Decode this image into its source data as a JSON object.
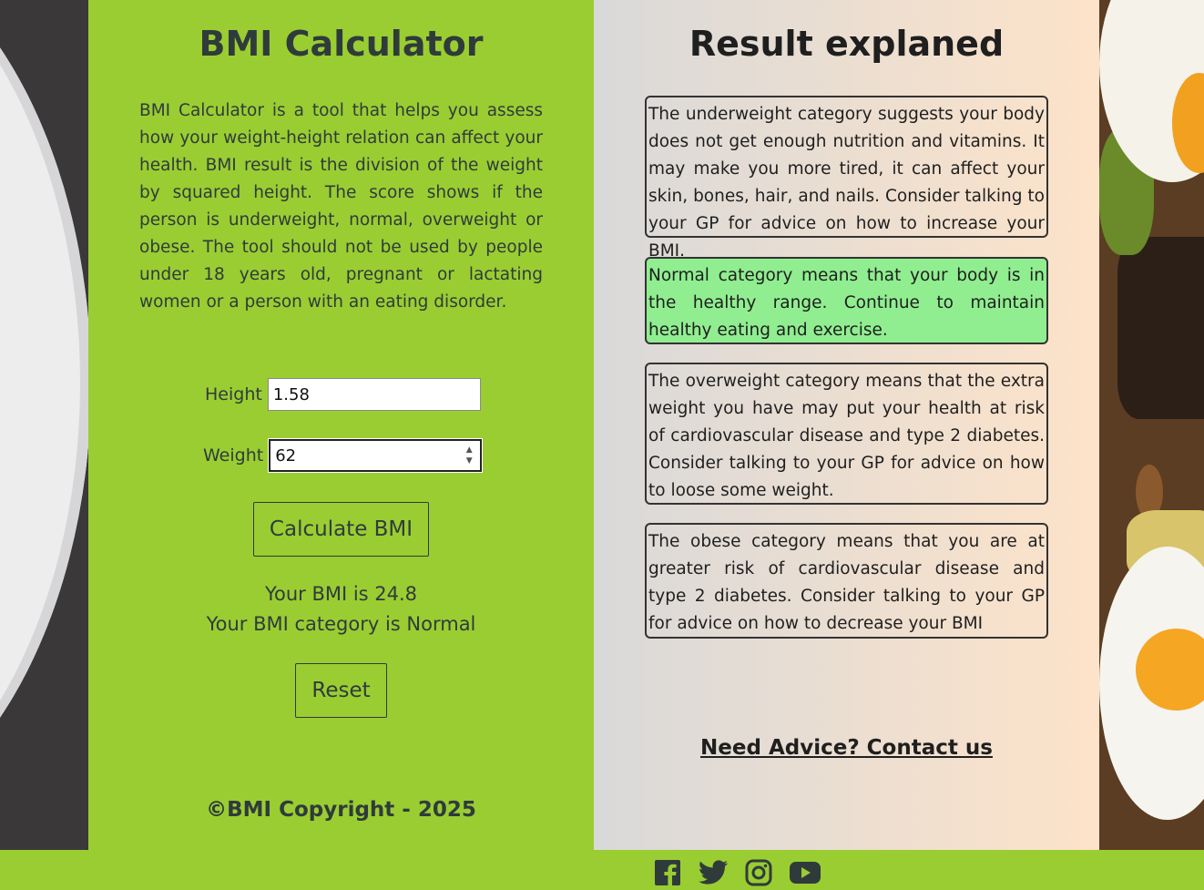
{
  "left": {
    "title": "BMI Calculator",
    "intro": "BMI Calculator is a tool that helps you assess how your weight-height relation can affect your health. BMI result is the division of the weight by squared height. The score shows if the person is underweight, normal, overweight or obese. The tool should not be used by people under 18 years old, pregnant or lactating women or a person with an eating disorder.",
    "height_label": "Height",
    "height_value": "1.58",
    "weight_label": "Weight",
    "weight_value": "62",
    "calculate_label": "Calculate BMI",
    "result_bmi": "Your BMI is 24.8",
    "result_category": "Your BMI category is Normal",
    "reset_label": "Reset",
    "copyright": "©BMI Copyright - 2025"
  },
  "right": {
    "title": "Result explaned",
    "underweight": "The underweight category suggests your body does not get enough nutrition and vitamins. It may make you more tired, it can affect your skin, bones, hair, and nails. Consider talking to your GP for advice on how to increase your BMI.",
    "normal": "Normal category means that your body is in the healthy range. Continue to maintain healthy eating and exercise.",
    "overweight": "The overweight category means that the extra weight you have may put your health at risk of cardiovascular disease and type 2 diabetes. Consider talking to your GP for advice on how to loose some weight.",
    "obese": "The obese category means that you are at greater risk of cardiovascular disease and type 2 diabetes. Consider talking to your GP for advice on how to decrease your BMI",
    "contact": "Need Advice? Contact us"
  },
  "colors": {
    "green": "#9acd32",
    "highlight": "#90ee90",
    "text": "#2f3b3b"
  },
  "footer": {
    "icons": [
      "facebook-icon",
      "twitter-icon",
      "instagram-icon",
      "youtube-icon"
    ]
  }
}
